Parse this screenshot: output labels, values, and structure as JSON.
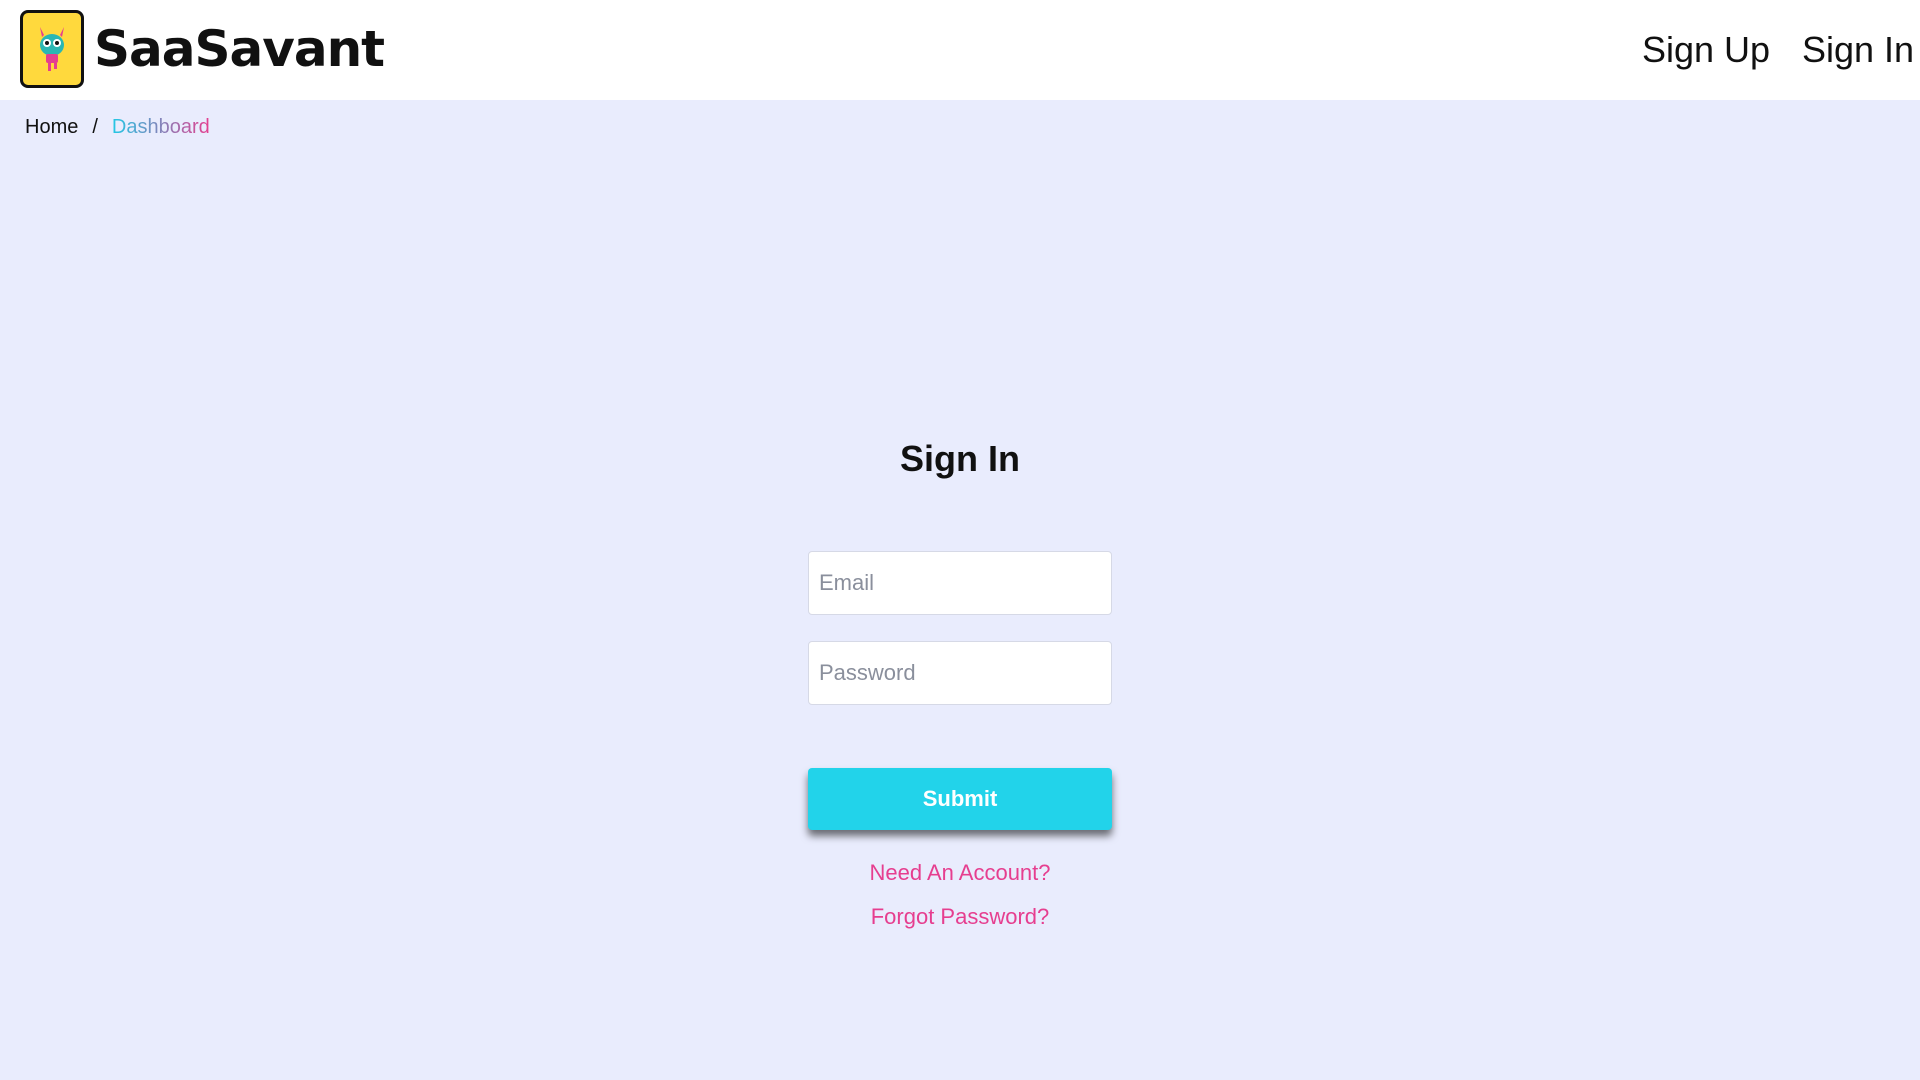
{
  "header": {
    "brand_name": "SaaSavant",
    "logo_icon": "monster-mascot-icon",
    "nav": {
      "sign_up": "Sign Up",
      "sign_in": "Sign In"
    }
  },
  "breadcrumb": {
    "home": "Home",
    "separator": "/",
    "current": "Dashboard"
  },
  "form": {
    "title": "Sign In",
    "email_placeholder": "Email",
    "password_placeholder": "Password",
    "submit_label": "Submit",
    "need_account_label": "Need An Account?",
    "forgot_password_label": "Forgot Password?"
  },
  "colors": {
    "header_bg": "#ffffff",
    "page_bg": "#e9ecfd",
    "logo_bg": "#ffd93d",
    "accent_cyan": "#22d3ea",
    "accent_pink": "#e63e8f",
    "text_dark": "#111111"
  }
}
